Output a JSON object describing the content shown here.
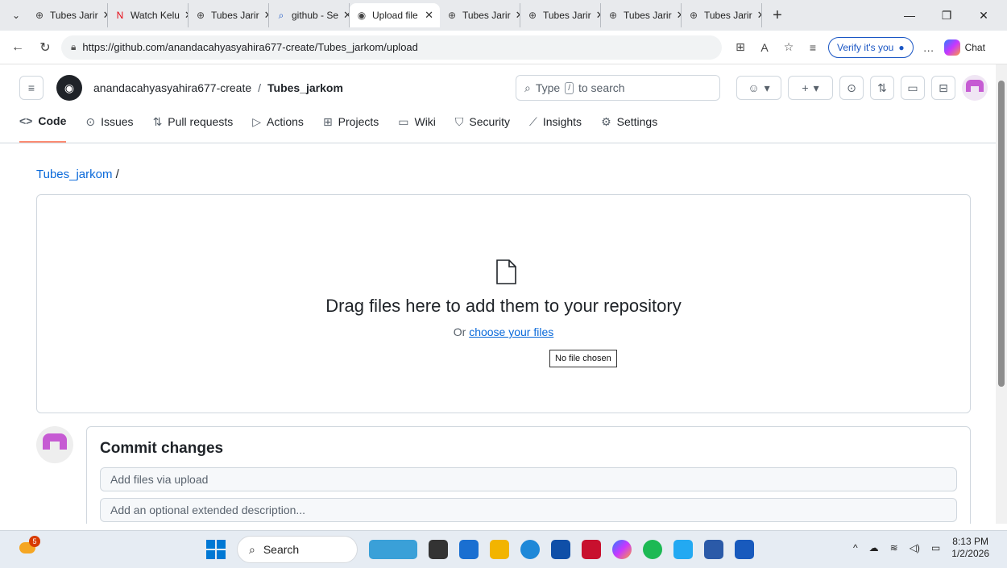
{
  "browser": {
    "tabs": [
      {
        "label": "Tubes Jarir",
        "icon": "globe-icon",
        "active": false
      },
      {
        "label": "Watch Kelu",
        "icon": "netflix-icon",
        "active": false
      },
      {
        "label": "Tubes Jarir",
        "icon": "globe-icon",
        "active": false
      },
      {
        "label": "github - Se",
        "icon": "search-icon",
        "active": false
      },
      {
        "label": "Upload file",
        "icon": "github-icon",
        "active": true
      },
      {
        "label": "Tubes Jarir",
        "icon": "globe-icon",
        "active": false
      },
      {
        "label": "Tubes Jarir",
        "icon": "globe-icon",
        "active": false
      },
      {
        "label": "Tubes Jarir",
        "icon": "globe-icon",
        "active": false
      },
      {
        "label": "Tubes Jarir",
        "icon": "globe-icon",
        "active": false
      }
    ],
    "url": "https://github.com/anandacahyasyahira677-create/Tubes_jarkom/upload",
    "verify_label": "Verify it's you",
    "chat_label": "Chat"
  },
  "header": {
    "owner": "anandacahyasyahira677-create",
    "separator": "/",
    "repo": "Tubes_jarkom",
    "search_prefix": "Type",
    "search_key": "/",
    "search_suffix": "to search"
  },
  "repo_nav": [
    {
      "label": "Code",
      "icon": "code-icon",
      "glyph": "<>",
      "active": true
    },
    {
      "label": "Issues",
      "icon": "issue-icon",
      "glyph": "⊙",
      "active": false
    },
    {
      "label": "Pull requests",
      "icon": "pull-request-icon",
      "glyph": "⇅",
      "active": false
    },
    {
      "label": "Actions",
      "icon": "play-icon",
      "glyph": "▷",
      "active": false
    },
    {
      "label": "Projects",
      "icon": "table-icon",
      "glyph": "⊞",
      "active": false
    },
    {
      "label": "Wiki",
      "icon": "book-icon",
      "glyph": "▭",
      "active": false
    },
    {
      "label": "Security",
      "icon": "shield-icon",
      "glyph": "⛉",
      "active": false
    },
    {
      "label": "Insights",
      "icon": "graph-icon",
      "glyph": "⟋",
      "active": false
    },
    {
      "label": "Settings",
      "icon": "gear-icon",
      "glyph": "⚙",
      "active": false
    }
  ],
  "path": {
    "repo_link": "Tubes_jarkom",
    "separator": "/"
  },
  "dropzone": {
    "title": "Drag files here to add them to your repository",
    "or_text": "Or",
    "choose_link": "choose your files",
    "no_file": "No file chosen"
  },
  "commit": {
    "title": "Commit changes",
    "message_placeholder": "Add files via upload",
    "description_placeholder": "Add an optional extended description..."
  },
  "taskbar": {
    "weather_badge": "5",
    "search_label": "Search",
    "time": "8:13 PM",
    "date": "1/2/2026"
  }
}
